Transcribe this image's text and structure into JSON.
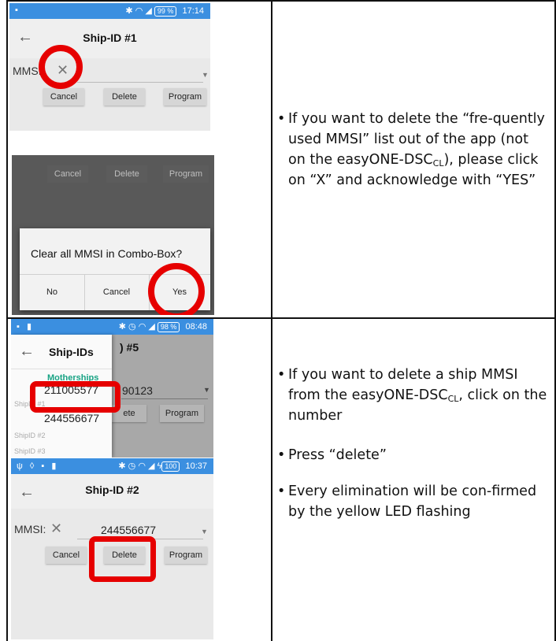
{
  "row1": {
    "shot_a": {
      "status_time": "17:14",
      "battery": "99 %",
      "title": "Ship-ID #1",
      "mmsi_label": "MMSI:",
      "clear_icon": "close-icon",
      "buttons": {
        "cancel": "Cancel",
        "delete": "Delete",
        "program": "Program"
      }
    },
    "shot_b": {
      "buttons": {
        "cancel": "Cancel",
        "delete": "Delete",
        "program": "Program"
      },
      "dialog": {
        "message": "Clear all MMSI in Combo-Box?",
        "no": "No",
        "cancel": "Cancel",
        "yes": "Yes"
      }
    },
    "instructions": [
      "If you want to delete the “fre-quently used MMSI” list out of the app (not on the easyONE-DSC",
      "CL",
      "), please click on “X” and acknowledge with “YES”"
    ]
  },
  "row2": {
    "shot_c": {
      "status_time": "08:48",
      "battery": "98 %",
      "drawer_title": "Ship-IDs",
      "behind_title": ") #5",
      "group_label": "Motherships",
      "items": [
        "211005577",
        "244556677"
      ],
      "sub_labels": [
        "ShipID #1",
        "ShipID #2",
        "ShipID #3"
      ],
      "behind_value": "90123",
      "behind_delete": "ete",
      "behind_program": "Program"
    },
    "shot_d": {
      "status_time": "10:37",
      "battery": "100",
      "title": "Ship-ID #2",
      "mmsi_label": "MMSI:",
      "mmsi_value": "244556677",
      "buttons": {
        "cancel": "Cancel",
        "delete": "Delete",
        "program": "Program"
      }
    },
    "instructions": {
      "delete_ship_pre": "If you want to delete a ship MMSI from the easyONE-DSC",
      "delete_ship_sub": "CL",
      "delete_ship_post": ", click on the number",
      "press_delete": "Press “delete”",
      "confirmation": "Every elimination will be con-firmed by the yellow LED flashing"
    }
  },
  "colors": {
    "status_bar": "#3b8fe0",
    "highlight": "#e60000",
    "accent_green": "#18a384"
  }
}
